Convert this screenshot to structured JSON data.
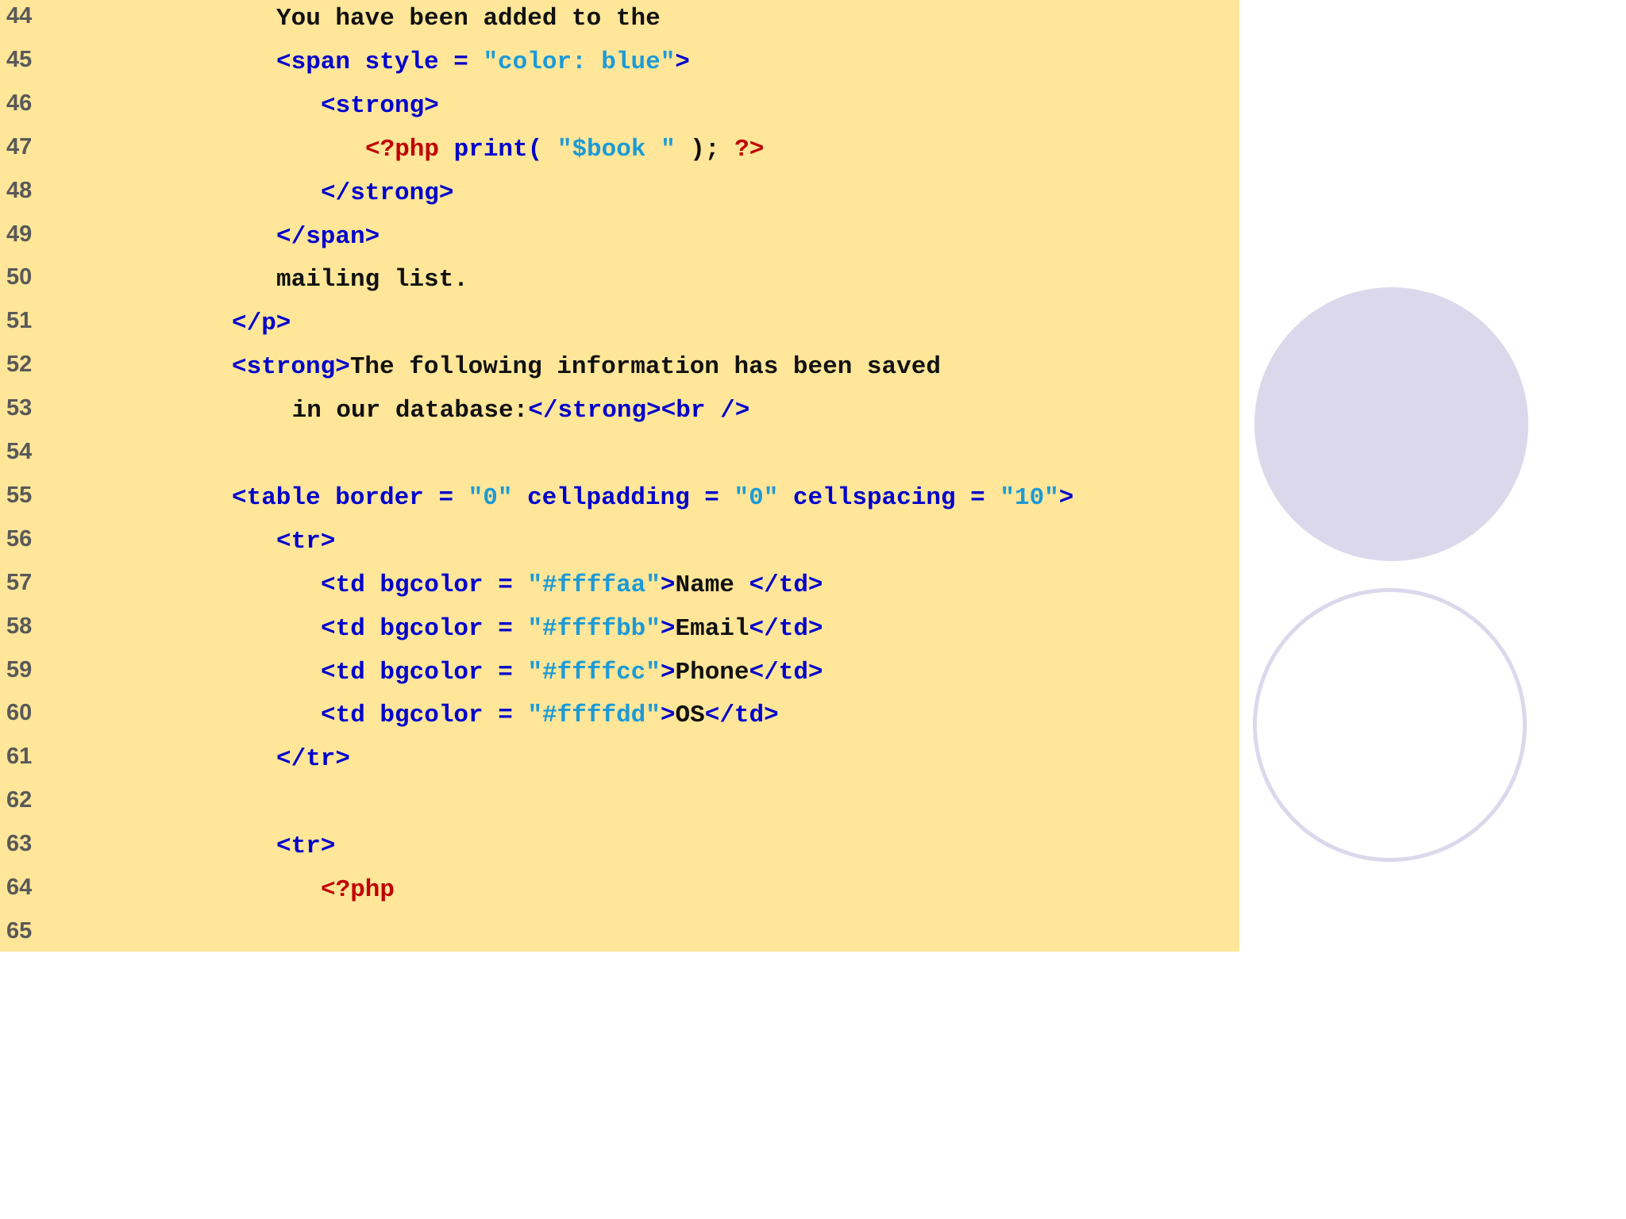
{
  "code_lines": [
    {
      "num": "44",
      "indent": 4,
      "tokens": [
        {
          "t": "You have been added to the",
          "c": "plain"
        }
      ]
    },
    {
      "num": "45",
      "indent": 4,
      "tokens": [
        {
          "t": "<span style = ",
          "c": "markup"
        },
        {
          "t": "\"color: blue\"",
          "c": "string"
        },
        {
          "t": ">",
          "c": "markup"
        }
      ]
    },
    {
      "num": "46",
      "indent": 5,
      "tokens": [
        {
          "t": "<strong>",
          "c": "markup"
        }
      ]
    },
    {
      "num": "47",
      "indent": 6,
      "tokens": [
        {
          "t": "<?php",
          "c": "php"
        },
        {
          "t": " print( ",
          "c": "markup"
        },
        {
          "t": "\"$book \"",
          "c": "string"
        },
        {
          "t": " ); ",
          "c": "plain"
        },
        {
          "t": "?>",
          "c": "php"
        }
      ]
    },
    {
      "num": "48",
      "indent": 5,
      "tokens": [
        {
          "t": "</strong>",
          "c": "markup"
        }
      ]
    },
    {
      "num": "49",
      "indent": 4,
      "tokens": [
        {
          "t": "</span>",
          "c": "markup"
        }
      ]
    },
    {
      "num": "50",
      "indent": 4,
      "tokens": [
        {
          "t": "mailing list.",
          "c": "plain"
        }
      ]
    },
    {
      "num": "51",
      "indent": 3,
      "tokens": [
        {
          "t": "</p>",
          "c": "markup"
        }
      ]
    },
    {
      "num": "52",
      "indent": 3,
      "tokens": [
        {
          "t": "<strong>",
          "c": "markup"
        },
        {
          "t": "The following information has been saved",
          "c": "plain"
        }
      ]
    },
    {
      "num": "53",
      "indent": 4.35,
      "tokens": [
        {
          "t": "in our database:",
          "c": "plain"
        },
        {
          "t": "</strong><br />",
          "c": "markup"
        }
      ]
    },
    {
      "num": "54",
      "indent": 0,
      "tokens": []
    },
    {
      "num": "55",
      "indent": 3,
      "tokens": [
        {
          "t": "<table border = ",
          "c": "markup"
        },
        {
          "t": "\"0\"",
          "c": "string"
        },
        {
          "t": " cellpadding = ",
          "c": "markup"
        },
        {
          "t": "\"0\"",
          "c": "string"
        },
        {
          "t": " cellspacing = ",
          "c": "markup"
        },
        {
          "t": "\"10\"",
          "c": "string"
        },
        {
          "t": ">",
          "c": "markup"
        }
      ]
    },
    {
      "num": "56",
      "indent": 4,
      "tokens": [
        {
          "t": "<tr>",
          "c": "markup"
        }
      ]
    },
    {
      "num": "57",
      "indent": 5,
      "tokens": [
        {
          "t": "<td bgcolor = ",
          "c": "markup"
        },
        {
          "t": "\"#ffffaa\"",
          "c": "string"
        },
        {
          "t": ">",
          "c": "markup"
        },
        {
          "t": "Name ",
          "c": "plain"
        },
        {
          "t": "</td>",
          "c": "markup"
        }
      ]
    },
    {
      "num": "58",
      "indent": 5,
      "tokens": [
        {
          "t": "<td bgcolor = ",
          "c": "markup"
        },
        {
          "t": "\"#ffffbb\"",
          "c": "string"
        },
        {
          "t": ">",
          "c": "markup"
        },
        {
          "t": "Email",
          "c": "plain"
        },
        {
          "t": "</td>",
          "c": "markup"
        }
      ]
    },
    {
      "num": "59",
      "indent": 5,
      "tokens": [
        {
          "t": "<td bgcolor = ",
          "c": "markup"
        },
        {
          "t": "\"#ffffcc\"",
          "c": "string"
        },
        {
          "t": ">",
          "c": "markup"
        },
        {
          "t": "Phone",
          "c": "plain"
        },
        {
          "t": "</td>",
          "c": "markup"
        }
      ]
    },
    {
      "num": "60",
      "indent": 5,
      "tokens": [
        {
          "t": "<td bgcolor = ",
          "c": "markup"
        },
        {
          "t": "\"#ffffdd\"",
          "c": "string"
        },
        {
          "t": ">",
          "c": "markup"
        },
        {
          "t": "OS",
          "c": "plain"
        },
        {
          "t": "</td>",
          "c": "markup"
        }
      ]
    },
    {
      "num": "61",
      "indent": 4,
      "tokens": [
        {
          "t": "</tr>",
          "c": "markup"
        }
      ]
    },
    {
      "num": "62",
      "indent": 0,
      "tokens": []
    },
    {
      "num": "63",
      "indent": 4,
      "tokens": [
        {
          "t": "<tr>",
          "c": "markup"
        }
      ]
    },
    {
      "num": "64",
      "indent": 5,
      "tokens": [
        {
          "t": "<?php",
          "c": "php"
        }
      ]
    },
    {
      "num": "65",
      "indent": 0,
      "tokens": []
    }
  ],
  "colors": {
    "panel_background": "#ffe699",
    "markup": "#0000cc",
    "string": "#1c9ad6",
    "php": "#c00000",
    "plain": "#111111",
    "line_number": "#595959",
    "decor_circle": "#dcd8ec"
  }
}
